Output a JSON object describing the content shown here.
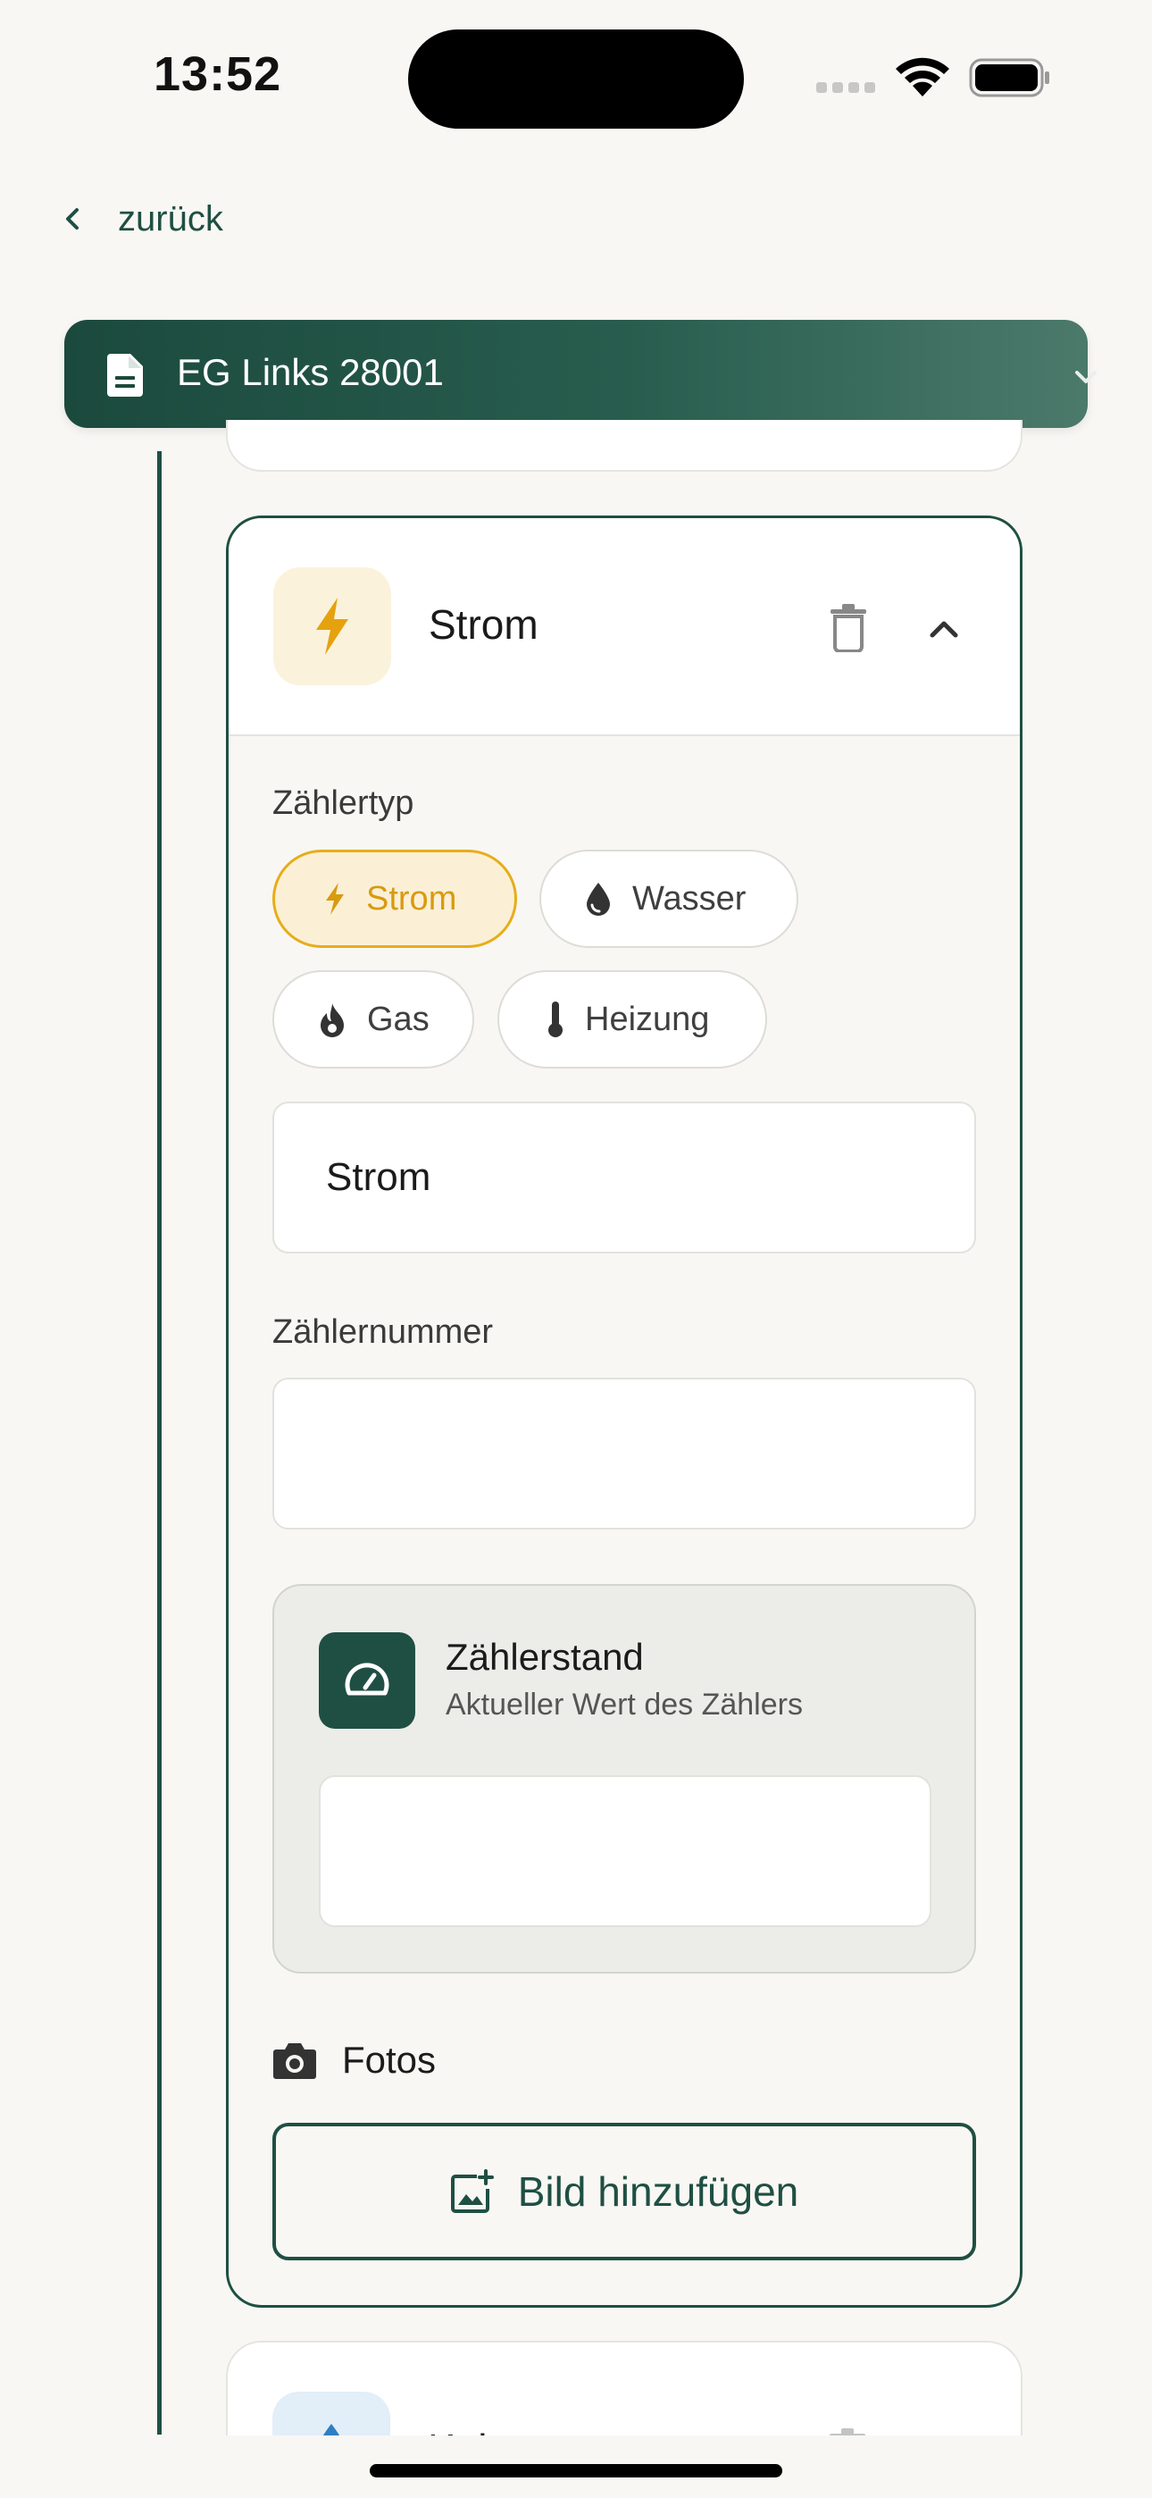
{
  "status_bar": {
    "time": "13:52"
  },
  "nav": {
    "back_label": "zurück"
  },
  "header": {
    "title": "EG Links 28001"
  },
  "meter_card": {
    "title": "Strom",
    "type_label": "Zählertyp",
    "types": [
      {
        "label": "Strom",
        "icon": "bolt-icon",
        "selected": true
      },
      {
        "label": "Wasser",
        "icon": "water-drop-icon",
        "selected": false
      },
      {
        "label": "Gas",
        "icon": "flame-icon",
        "selected": false
      },
      {
        "label": "Heizung",
        "icon": "thermometer-icon",
        "selected": false
      }
    ],
    "name_value": "Strom",
    "number_label": "Zählernummer",
    "number_value": "",
    "reading": {
      "title": "Zählerstand",
      "subtitle": "Aktueller Wert des Zählers",
      "value": ""
    },
    "photos_label": "Fotos",
    "add_photo_label": "Bild hinzufügen"
  },
  "next_card": {
    "title": "Kalt"
  },
  "colors": {
    "brand": "#1f4f43",
    "accent": "#e7ad19",
    "background": "#f8f7f4"
  }
}
